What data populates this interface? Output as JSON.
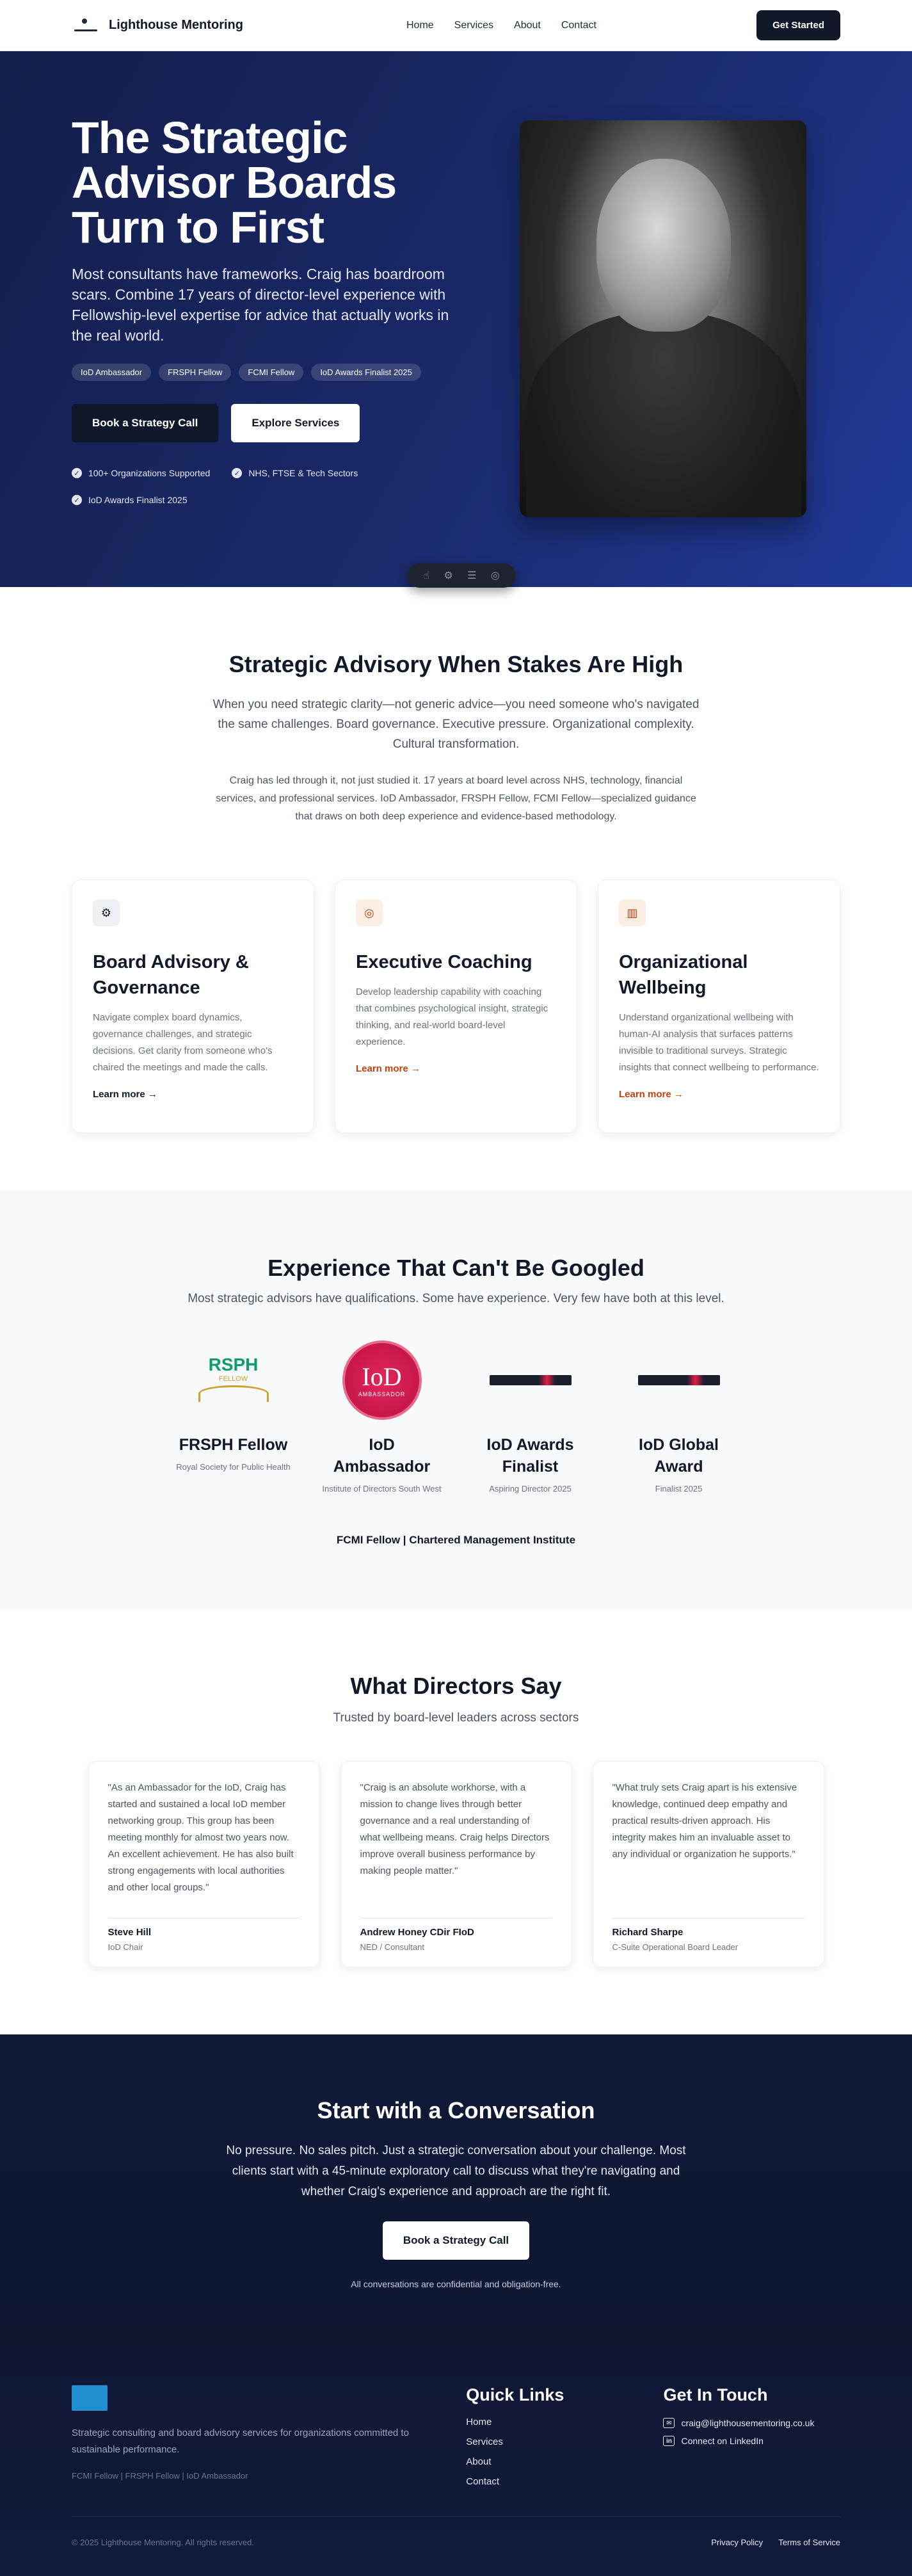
{
  "nav": {
    "brand": "Lighthouse Mentoring",
    "links": [
      "Home",
      "Services",
      "About",
      "Contact"
    ],
    "cta": "Get Started"
  },
  "hero": {
    "title": "The Strategic Advisor Boards Turn to First",
    "subtitle": "Most consultants have frameworks. Craig has boardroom scars. Combine 17 years of director-level experience with Fellowship-level expertise for advice that actually works in the real world.",
    "badges": [
      "IoD Ambassador",
      "FRSPH Fellow",
      "FCMI Fellow",
      "IoD Awards Finalist 2025"
    ],
    "primary_button": "Book a Strategy Call",
    "secondary_button": "Explore Services",
    "checks": [
      "100+ Organizations Supported",
      "NHS, FTSE & Tech Sectors",
      "IoD Awards Finalist 2025"
    ]
  },
  "advisory": {
    "title": "Strategic Advisory When Stakes Are High",
    "p1": "When you need strategic clarity—not generic advice—you need someone who's navigated the same challenges. Board governance. Executive pressure. Organizational complexity. Cultural transformation.",
    "p2": "Craig has led through it, not just studied it. 17 years at board level across NHS, technology, financial services, and professional services. IoD Ambassador, FRSPH Fellow, FCMI Fellow—specialized guidance that draws on both deep experience and evidence-based methodology.",
    "cards": [
      {
        "title": "Board Advisory & Governance",
        "text": "Navigate complex board dynamics, governance challenges, and strategic decisions. Get clarity from someone who's chaired the meetings and made the calls.",
        "link": "Learn more →",
        "icon": "boardroom-icon",
        "accent": "#111827",
        "icon_bg": "#eef0f3"
      },
      {
        "title": "Executive Coaching",
        "text": "Develop leadership capability with coaching that combines psychological insight, strategic thinking, and real-world board-level experience.",
        "link": "Learn more →",
        "icon": "target-icon",
        "accent": "#c2410c",
        "icon_bg": "#fdeee4"
      },
      {
        "title": "Organizational Wellbeing",
        "text": "Understand organizational wellbeing with human-AI analysis that surfaces patterns invisible to traditional surveys. Strategic insights that connect wellbeing to performance.",
        "link": "Learn more →",
        "icon": "bar-chart-icon",
        "accent": "#c2410c",
        "icon_bg": "#fdeee4"
      }
    ]
  },
  "experience": {
    "title": "Experience That Can't Be Googled",
    "subtitle": "Most strategic advisors have qualifications. Some have experience. Very few have both at this level.",
    "rsph_logo": {
      "top": "RSPH",
      "middle": "FELLOW"
    },
    "iod_logo": {
      "mark": "IoD",
      "ring": "AMBASSADOR"
    },
    "creds": [
      {
        "name": "FRSPH Fellow",
        "sub": "Royal Society for Public Health"
      },
      {
        "name": "IoD Ambassador",
        "sub": "Institute of Directors South West"
      },
      {
        "name": "IoD Awards Finalist",
        "sub": "Aspiring Director 2025"
      },
      {
        "name": "IoD Global Award",
        "sub": "Finalist 2025"
      }
    ],
    "footer_line": "FCMI Fellow | Chartered Management Institute"
  },
  "testimonials": {
    "title": "What Directors Say",
    "subtitle": "Trusted by board-level leaders across sectors",
    "items": [
      {
        "quote": "\"As an Ambassador for the IoD, Craig has started and sustained a local IoD member networking group. This group has been meeting monthly for almost two years now. An excellent achievement. He has also built strong engagements with local authorities and other local groups.\"",
        "name": "Steve Hill",
        "role": "IoD Chair"
      },
      {
        "quote": "\"Craig is an absolute workhorse, with a mission to change lives through better governance and a real understanding of what wellbeing means. Craig helps Directors improve overall business performance by making people matter.\"",
        "name": "Andrew Honey CDir FIoD",
        "role": "NED / Consultant"
      },
      {
        "quote": "\"What truly sets Craig apart is his extensive knowledge, continued deep empathy and practical results-driven approach. His integrity makes him an invaluable asset to any individual or organization he supports.\"",
        "name": "Richard Sharpe",
        "role": "C-Suite Operational Board Leader"
      }
    ]
  },
  "cta": {
    "title": "Start with a Conversation",
    "text": "No pressure. No sales pitch. Just a strategic conversation about your challenge. Most clients start with a 45-minute exploratory call to discuss what they're navigating and whether Craig's experience and approach are the right fit.",
    "button": "Book a Strategy Call",
    "note": "All conversations are confidential and obligation-free."
  },
  "footer": {
    "desc": "Strategic consulting and board advisory services for organizations committed to sustainable performance.",
    "creds": "FCMI Fellow | FRSPH Fellow | IoD Ambassador",
    "quick_links_title": "Quick Links",
    "quick_links": [
      "Home",
      "Services",
      "About",
      "Contact"
    ],
    "contact_title": "Get In Touch",
    "email": "craig@lighthousementoring.co.uk",
    "linkedin": "Connect on LinkedIn",
    "copyright": "© 2025 Lighthouse Mentoring. All rights reserved.",
    "privacy": "Privacy Policy",
    "terms": "Terms of Service"
  }
}
